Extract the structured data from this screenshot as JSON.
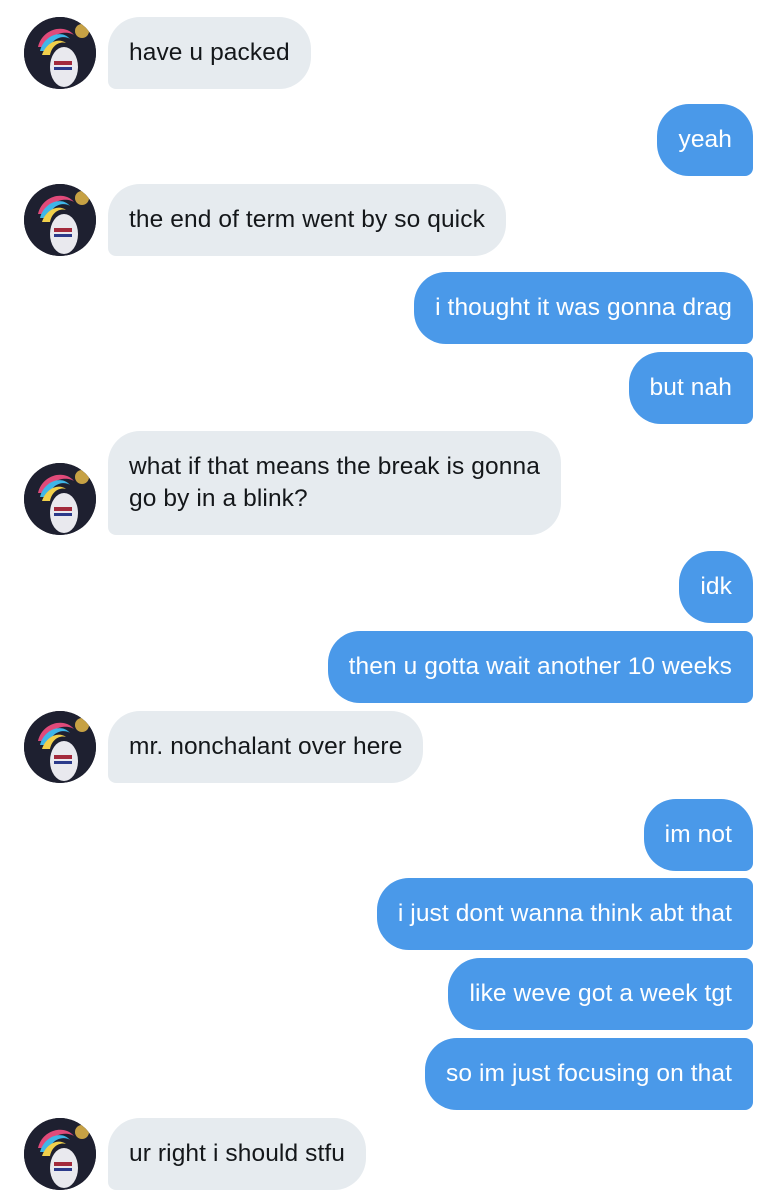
{
  "conversation": {
    "messages": [
      {
        "sender": "them",
        "text": "have u packed"
      },
      {
        "sender": "me",
        "text": "yeah"
      },
      {
        "sender": "them",
        "text": "the end of term went by so quick"
      },
      {
        "sender": "me",
        "text": "i thought it was gonna drag"
      },
      {
        "sender": "me",
        "text": "but nah"
      },
      {
        "sender": "them",
        "text_line1": "what if that means the break is gonna",
        "text_line2": "go by in a blink?"
      },
      {
        "sender": "me",
        "text": "idk"
      },
      {
        "sender": "me",
        "text": "then u gotta wait another 10 weeks"
      },
      {
        "sender": "them",
        "text": "mr. nonchalant over here"
      },
      {
        "sender": "me",
        "text": "im not"
      },
      {
        "sender": "me",
        "text": "i just dont wanna think abt that"
      },
      {
        "sender": "me",
        "text": "like weve got a week tgt"
      },
      {
        "sender": "me",
        "text": "so im just focusing on that"
      },
      {
        "sender": "them",
        "text": "ur right i should stfu"
      }
    ]
  },
  "colors": {
    "incoming_bubble": "#e6ebef",
    "outgoing_bubble": "#4a99e9",
    "incoming_text": "#14171a",
    "outgoing_text": "#ffffff"
  },
  "icons": {
    "avatar": "contact-avatar-photo"
  }
}
